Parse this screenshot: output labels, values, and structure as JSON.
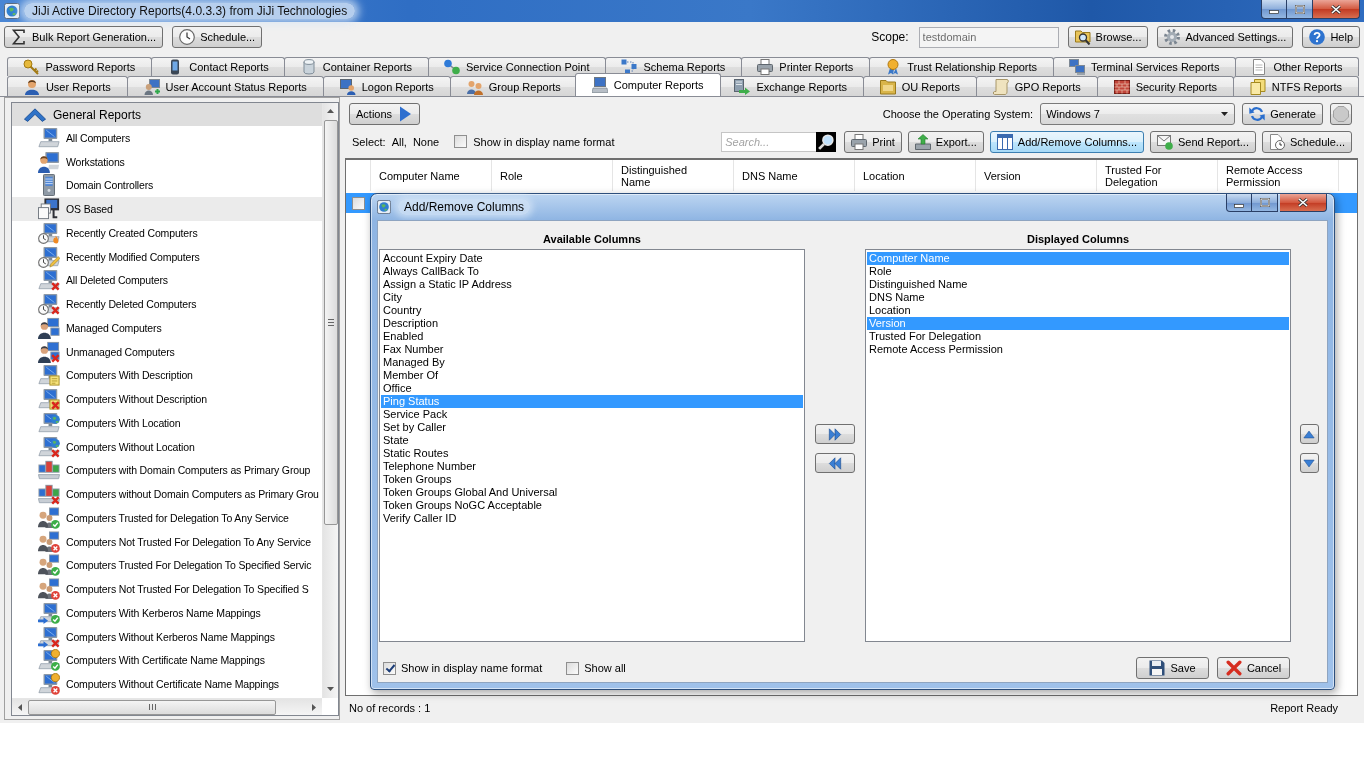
{
  "window": {
    "title": "JiJi Active Directory Reports(4.0.3.3) from JiJi Technologies"
  },
  "toolbar": {
    "left_buttons": [
      {
        "label": "Bulk Report Generation..."
      },
      {
        "label": "Schedule..."
      }
    ],
    "scope": {
      "label": "Scope:",
      "value": "testdomain",
      "disabled": true
    },
    "right_buttons": [
      {
        "label": "Browse..."
      },
      {
        "label": "Advanced Settings..."
      },
      {
        "label": "Help"
      }
    ]
  },
  "tab_rows": [
    {
      "tabs": [
        {
          "label": "Password Reports",
          "selected": false
        },
        {
          "label": "Contact Reports",
          "selected": false
        },
        {
          "label": "Container Reports",
          "selected": false
        },
        {
          "label": "Service Connection Point",
          "selected": false
        },
        {
          "label": "Schema Reports",
          "selected": false
        },
        {
          "label": "Printer Reports",
          "selected": false
        },
        {
          "label": "Trust Relationship Reports",
          "selected": false
        },
        {
          "label": "Terminal Services Reports",
          "selected": false
        },
        {
          "label": "Other Reports",
          "selected": false
        }
      ]
    },
    {
      "tabs": [
        {
          "label": "User Reports",
          "selected": false
        },
        {
          "label": "User Account Status Reports",
          "selected": false
        },
        {
          "label": "Logon Reports",
          "selected": false
        },
        {
          "label": "Group Reports",
          "selected": false
        },
        {
          "label": "Computer Reports",
          "selected": true
        },
        {
          "label": "Exchange Reports",
          "selected": false
        },
        {
          "label": "OU Reports",
          "selected": false
        },
        {
          "label": "GPO Reports",
          "selected": false
        },
        {
          "label": "Security Reports",
          "selected": false
        },
        {
          "label": "NTFS Reports",
          "selected": false
        }
      ]
    }
  ],
  "sidebar": {
    "groups": [
      {
        "label": "General Reports",
        "expanded": true,
        "children": [
          {
            "label": "All Computers",
            "selected": false
          },
          {
            "label": "Workstations",
            "selected": false
          },
          {
            "label": "Domain Controllers",
            "selected": false
          },
          {
            "label": "OS Based",
            "selected": true
          },
          {
            "label": "Recently Created Computers",
            "selected": false
          },
          {
            "label": "Recently Modified Computers",
            "selected": false
          },
          {
            "label": "All Deleted Computers",
            "selected": false
          },
          {
            "label": "Recently Deleted Computers",
            "selected": false
          },
          {
            "label": "Managed Computers",
            "selected": false
          },
          {
            "label": "Unmanaged Computers",
            "selected": false
          },
          {
            "label": "Computers With Description",
            "selected": false
          },
          {
            "label": "Computers Without Description",
            "selected": false
          },
          {
            "label": "Computers With Location",
            "selected": false
          },
          {
            "label": "Computers Without Location",
            "selected": false
          },
          {
            "label": "Computers with Domain Computers as Primary Group",
            "selected": false
          },
          {
            "label": "Computers without Domain Computers as Primary Grou",
            "selected": false
          },
          {
            "label": "Computers Trusted for Delegation To Any Service",
            "selected": false
          },
          {
            "label": "Computers Not Trusted For Delegation To Any Service",
            "selected": false
          },
          {
            "label": "Computers Trusted For Delegation To Specified Servic",
            "selected": false
          },
          {
            "label": "Computers Not Trusted For Delegation To Specified S",
            "selected": false
          },
          {
            "label": "Computers With Kerberos Name Mappings",
            "selected": false
          },
          {
            "label": "Computers Without Kerberos Name Mappings",
            "selected": false
          },
          {
            "label": "Computers With Certificate Name Mappings",
            "selected": false
          },
          {
            "label": "Computers Without Certificate Name Mappings",
            "selected": false
          }
        ]
      }
    ]
  },
  "report_panel": {
    "actions_button": "Actions",
    "os_label": "Choose the Operating System:",
    "os_select": {
      "value": "Windows 7"
    },
    "generate_button": "Generate",
    "select_label": "Select:",
    "select_links": [
      "All,",
      "None"
    ],
    "display_name_option": {
      "label": "Show in display name format",
      "checked": false
    },
    "search": {
      "placeholder": "Search..."
    },
    "buttons": [
      {
        "label": "Print",
        "highlighted": false
      },
      {
        "label": "Export...",
        "highlighted": false
      },
      {
        "label": "Add/Remove Columns...",
        "highlighted": true
      },
      {
        "label": "Send Report...",
        "highlighted": false
      },
      {
        "label": "Schedule...",
        "highlighted": false
      }
    ],
    "table": {
      "columns": [
        "Computer Name",
        "Role",
        "Distinguished Name",
        "DNS Name",
        "Location",
        "Version",
        "Trusted For Delegation",
        "Remote Access Permission"
      ],
      "rows": [
        {
          "selected": true,
          "checked": false
        }
      ]
    },
    "status_bar": {
      "records": "No of records : 1",
      "status": "Report Ready"
    }
  },
  "dialog": {
    "title": "Add/Remove Columns",
    "available": {
      "heading": "Available Columns",
      "items": [
        {
          "label": "Account Expiry Date",
          "selected": false
        },
        {
          "label": "Always CallBack To",
          "selected": false
        },
        {
          "label": "Assign a Static IP Address",
          "selected": false
        },
        {
          "label": "City",
          "selected": false
        },
        {
          "label": "Country",
          "selected": false
        },
        {
          "label": "Description",
          "selected": false
        },
        {
          "label": "Enabled",
          "selected": false
        },
        {
          "label": "Fax Number",
          "selected": false
        },
        {
          "label": "Managed By",
          "selected": false
        },
        {
          "label": "Member Of",
          "selected": false
        },
        {
          "label": "Office",
          "selected": false
        },
        {
          "label": "Ping Status",
          "selected": true
        },
        {
          "label": "Service Pack",
          "selected": false
        },
        {
          "label": "Set by Caller",
          "selected": false
        },
        {
          "label": "State",
          "selected": false
        },
        {
          "label": "Static Routes",
          "selected": false
        },
        {
          "label": "Telephone Number",
          "selected": false
        },
        {
          "label": "Token Groups",
          "selected": false
        },
        {
          "label": "Token Groups Global And Universal",
          "selected": false
        },
        {
          "label": "Token Groups NoGC Acceptable",
          "selected": false
        },
        {
          "label": "Verify Caller ID",
          "selected": false
        }
      ]
    },
    "displayed": {
      "heading": "Displayed Columns",
      "items": [
        {
          "label": "Computer Name",
          "selected": true
        },
        {
          "label": "Role",
          "selected": false
        },
        {
          "label": "Distinguished Name",
          "selected": false
        },
        {
          "label": "DNS Name",
          "selected": false
        },
        {
          "label": "Location",
          "selected": false
        },
        {
          "label": "Version",
          "selected": true
        },
        {
          "label": "Trusted For Delegation",
          "selected": false
        },
        {
          "label": "Remote Access Permission",
          "selected": false
        }
      ]
    },
    "options": [
      {
        "label": "Show in display name format",
        "checked": true
      },
      {
        "label": "Show all",
        "checked": false
      }
    ],
    "buttons": [
      {
        "label": "Save"
      },
      {
        "label": "Cancel"
      }
    ]
  }
}
